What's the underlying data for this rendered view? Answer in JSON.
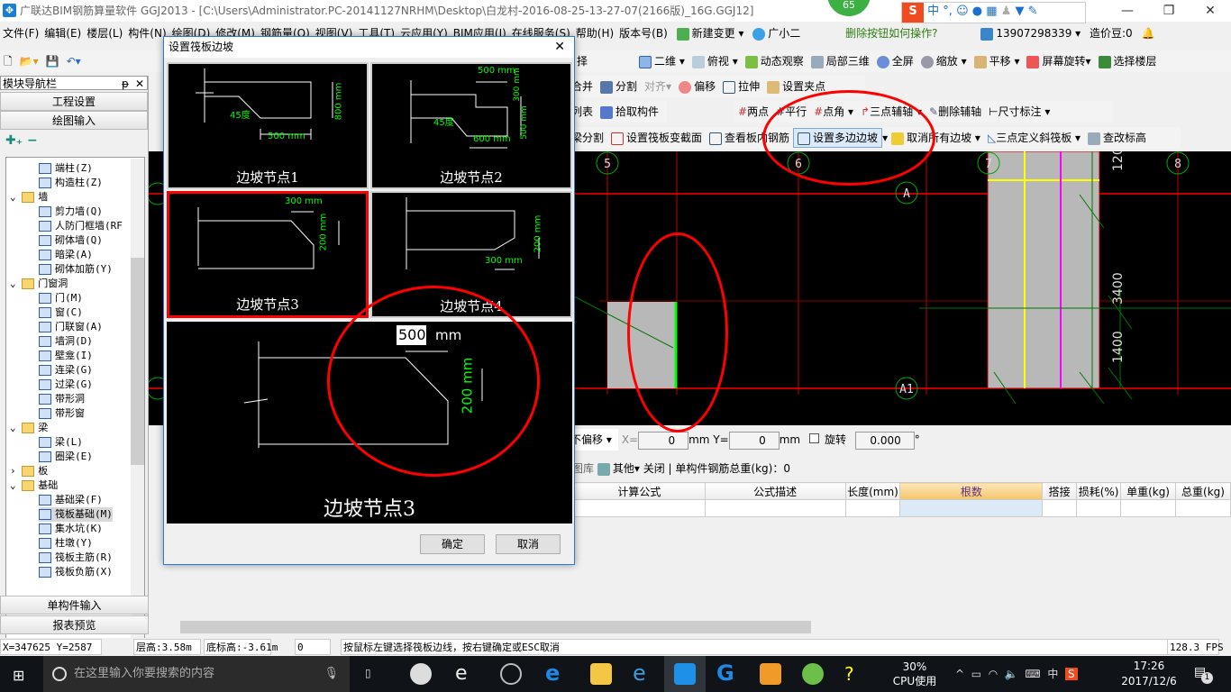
{
  "window": {
    "title": "广联达BIM钢筋算量软件 GGJ2013 - [C:\\Users\\Administrator.PC-20141127NRHM\\Desktop\\白龙村-2016-08-25-13-27-07(2166版)_16G.GGJ12]",
    "badge": "65",
    "min": "—",
    "max": "❐",
    "close": "✕"
  },
  "ime": {
    "items": [
      "S",
      "中",
      "°,",
      "☺",
      "🎤",
      "⌨",
      "👤",
      "👕",
      "🔧"
    ]
  },
  "menu": [
    "文件(F)",
    "编辑(E)",
    "楼层(L)",
    "构件(N)",
    "绘图(D)",
    "修改(M)",
    "钢筋量(Q)",
    "视图(V)",
    "工具(T)",
    "云应用(Y)",
    "BIM应用(I)",
    "在线服务(S)",
    "帮助(H)",
    "版本号(B)"
  ],
  "menu_extra": {
    "new_change": "新建变更",
    "assistant": "广小二",
    "help_link": "删除按钮如何操作?",
    "phone": "13907298339",
    "beans": "造价豆:0"
  },
  "toolbar1": [
    "二维",
    "俯视",
    "动态观察",
    "局部三维",
    "全屏",
    "缩放",
    "平移",
    "屏幕旋转",
    "选择楼层"
  ],
  "toolbar1_left": "择",
  "toolbar2": [
    "合并",
    "分割",
    "对齐",
    "偏移",
    "拉伸",
    "设置夹点"
  ],
  "toolbar3_left": [
    "列表",
    "拾取构件"
  ],
  "toolbar3": [
    "两点",
    "平行",
    "点角",
    "三点辅轴",
    "删除辅轴",
    "尺寸标注"
  ],
  "toolbar4": [
    "梁分割",
    "设置筏板变截面",
    "查看板内钢筋",
    "设置多边边坡",
    "取消所有边坡",
    "三点定义斜筏板",
    "查改标高"
  ],
  "nav": {
    "title": "模块导航栏",
    "pin": "ᵽ",
    "close": "✕",
    "project": "工程设置",
    "draw": "绘图输入",
    "single": "单构件输入",
    "report": "报表预览",
    "tree": [
      {
        "label": "端柱(Z)",
        "level": 2
      },
      {
        "label": "构造柱(Z)",
        "level": 2
      },
      {
        "label": "墙",
        "level": 1,
        "folder": true,
        "open": true
      },
      {
        "label": "剪力墙(Q)",
        "level": 2
      },
      {
        "label": "人防门框墙(RF",
        "level": 2
      },
      {
        "label": "砌体墙(Q)",
        "level": 2
      },
      {
        "label": "暗梁(A)",
        "level": 2
      },
      {
        "label": "砌体加筋(Y)",
        "level": 2
      },
      {
        "label": "门窗洞",
        "level": 1,
        "folder": true,
        "open": true
      },
      {
        "label": "门(M)",
        "level": 2
      },
      {
        "label": "窗(C)",
        "level": 2
      },
      {
        "label": "门联窗(A)",
        "level": 2
      },
      {
        "label": "墙洞(D)",
        "level": 2
      },
      {
        "label": "壁龛(I)",
        "level": 2
      },
      {
        "label": "连梁(G)",
        "level": 2
      },
      {
        "label": "过梁(G)",
        "level": 2
      },
      {
        "label": "带形洞",
        "level": 2
      },
      {
        "label": "带形窗",
        "level": 2
      },
      {
        "label": "梁",
        "level": 1,
        "folder": true,
        "open": true
      },
      {
        "label": "梁(L)",
        "level": 2
      },
      {
        "label": "圈梁(E)",
        "level": 2
      },
      {
        "label": "板",
        "level": 1,
        "folder": true,
        "open": false
      },
      {
        "label": "基础",
        "level": 1,
        "folder": true,
        "open": true
      },
      {
        "label": "基础梁(F)",
        "level": 2
      },
      {
        "label": "筏板基础(M)",
        "level": 2,
        "selected": true
      },
      {
        "label": "集水坑(K)",
        "level": 2
      },
      {
        "label": "柱墩(Y)",
        "level": 2
      },
      {
        "label": "筏板主筋(R)",
        "level": 2
      },
      {
        "label": "筏板负筋(X)",
        "level": 2
      }
    ]
  },
  "dialog": {
    "title": "设置筏板边坡",
    "close": "✕",
    "nodes": [
      {
        "caption": "边坡节点1",
        "dims": [
          "45度",
          "800 mm",
          "500 mm"
        ]
      },
      {
        "caption": "边坡节点2",
        "dims": [
          "500 mm",
          "300 mm",
          "500 mm",
          "45度",
          "600 mm"
        ]
      },
      {
        "caption": "边坡节点3",
        "dims": [
          "300 mm",
          "200 mm"
        ],
        "selected": true
      },
      {
        "caption": "边坡节点4",
        "dims": [
          "200 mm",
          "300 mm"
        ]
      }
    ],
    "preview": {
      "caption": "边坡节点3",
      "width_value": "500",
      "width_unit": "mm",
      "height_label": "200 mm"
    },
    "ok": "确定",
    "cancel": "取消"
  },
  "canvas": {
    "axes": [
      "5",
      "6",
      "7",
      "8",
      "A",
      "A1"
    ],
    "dims": [
      "120",
      "3400",
      "1400"
    ],
    "colors": {
      "grid": "#ff0000",
      "slab": "#b8b8b8",
      "edge": "#00ff00",
      "yellow": "#ffff00",
      "magenta": "#ff00ff"
    }
  },
  "offset_bar": {
    "mode": "不偏移",
    "x_label": "X=",
    "x": "0",
    "y_label": "Y=",
    "y": "0",
    "unit": "mm",
    "rotate": "旋转",
    "rotate_value": "0.000",
    "deg": "°"
  },
  "rebar_bar": {
    "lib": "图库",
    "other": "其他",
    "close": "关闭",
    "total": "单构件钢筋总重(kg)：0"
  },
  "table": {
    "columns": [
      "计算公式",
      "公式描述",
      "长度(mm)",
      "根数",
      "搭接",
      "损耗(%)",
      "单重(kg)",
      "总重(kg)"
    ]
  },
  "status": {
    "coords": "X=347625 Y=2587",
    "floor_height": "层高:3.58m",
    "bottom_elev": "底标高:-3.61m",
    "zero": "0",
    "hint": "按鼠标左键选择筏板边线，按右键确定或ESC取消",
    "fps": "128.3 FPS"
  },
  "taskbar": {
    "search": "在这里输入你要搜索的内容",
    "cpu_pct": "30%",
    "cpu_label": "CPU使用",
    "ime": "中",
    "time": "17:26",
    "date": "2017/12/6",
    "notif": "1"
  }
}
